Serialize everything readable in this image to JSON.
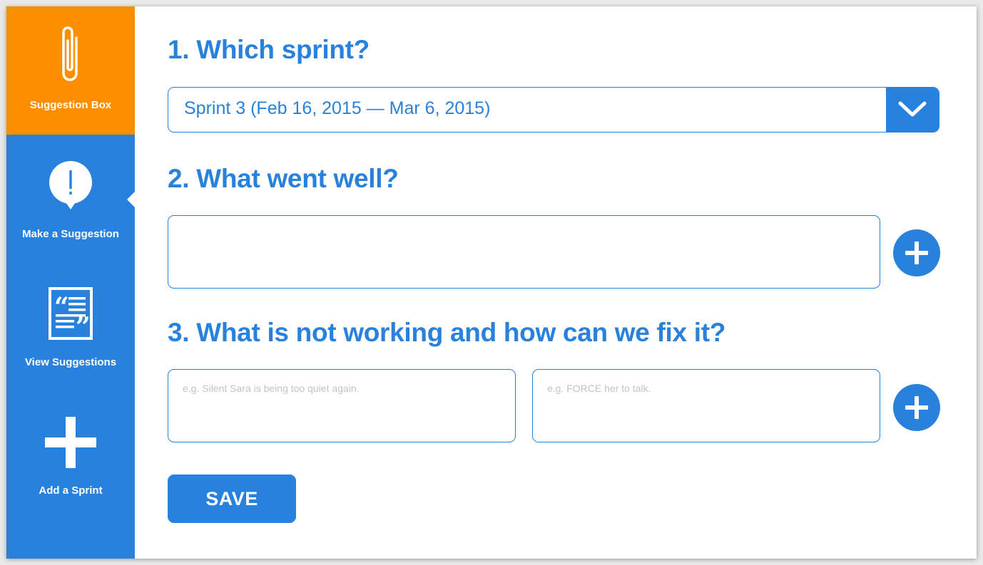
{
  "sidebar": {
    "brand": {
      "label": "Suggestion Box",
      "icon": "paperclip-icon",
      "color": "#fc8e00"
    },
    "items": [
      {
        "label": "Make a Suggestion",
        "icon": "speech-bubble-exclamation-icon",
        "active": true
      },
      {
        "label": "View Suggestions",
        "icon": "quote-document-icon",
        "active": false
      },
      {
        "label": "Add a Sprint",
        "icon": "plus-icon",
        "active": false
      }
    ],
    "color": "#2781dd"
  },
  "form": {
    "q1": "1. Which sprint?",
    "sprint_select": {
      "value": "Sprint 3 (Feb 16, 2015 — Mar 6, 2015)"
    },
    "q2": "2. What went well?",
    "went_well": {
      "value": "",
      "placeholder": ""
    },
    "q3": "3. What is not working and how can we fix it?",
    "problem": {
      "value": "",
      "placeholder": "e.g. Silent Sara is being too quiet again."
    },
    "fix": {
      "value": "",
      "placeholder": "e.g. FORCE her to talk."
    },
    "save_label": "SAVE"
  },
  "accent_color": "#2781dd"
}
